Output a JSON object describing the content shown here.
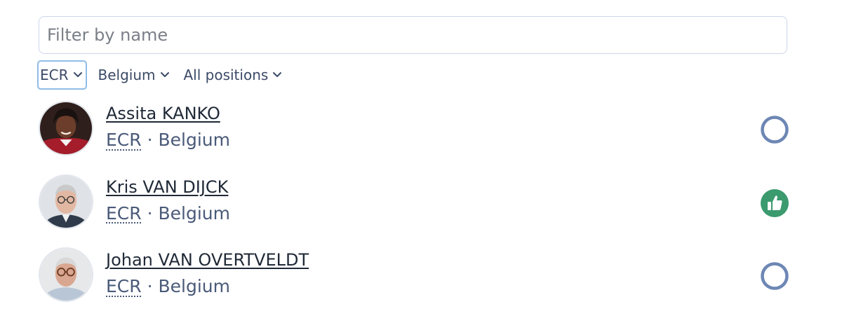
{
  "search": {
    "placeholder": "Filter by name",
    "value": ""
  },
  "filters": [
    {
      "label": "ECR",
      "active": true
    },
    {
      "label": "Belgium",
      "active": false
    },
    {
      "label": "All positions",
      "active": false
    }
  ],
  "members": [
    {
      "name": "Assita KANKO",
      "group": "ECR",
      "separator": " · ",
      "country": "Belgium",
      "position": "none",
      "position_icon": "empty-circle-icon"
    },
    {
      "name": "Kris VAN DIJCK",
      "group": "ECR",
      "separator": " · ",
      "country": "Belgium",
      "position": "for",
      "position_icon": "thumbs-up-icon"
    },
    {
      "name": "Johan VAN OVERTVELDT",
      "group": "ECR",
      "separator": " · ",
      "country": "Belgium",
      "position": "none",
      "position_icon": "empty-circle-icon"
    }
  ],
  "colors": {
    "accent_focus": "#8fbde8",
    "status_neutral": "#6d87b4",
    "status_for": "#3b9a6e",
    "text": "#2b3a55"
  }
}
